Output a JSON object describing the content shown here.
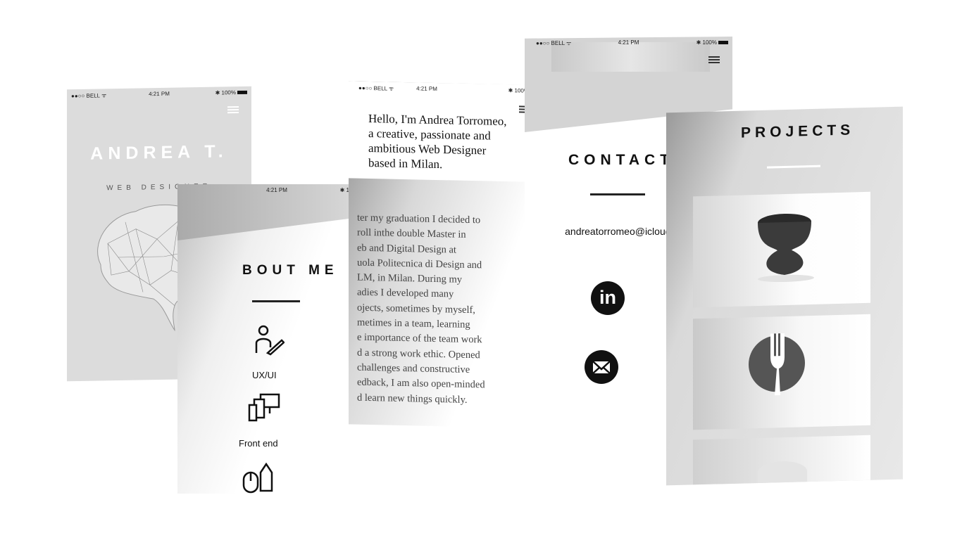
{
  "status": {
    "carrier": "●●○○ BELL ᯤ",
    "time": "4:21 PM",
    "battery": "✱ 100%"
  },
  "screen1": {
    "name": "ANDREA T.",
    "role": "WEB DESIGNER"
  },
  "screen2": {
    "title": "BOUT ME",
    "skills": [
      {
        "label": "UX/UI",
        "icon": "person-pen-icon"
      },
      {
        "label": "Front end",
        "icon": "devices-icon"
      },
      {
        "label": "",
        "icon": "mouse-pen-icon"
      }
    ]
  },
  "screen3": {
    "intro": "Hello, I'm Andrea Torromeo, a creative, passionate and ambitious Web Designer based in Milan.",
    "body_lines": [
      "ter my graduation I decided to",
      "roll inthe double Master in",
      "eb and Digital Design at",
      "uola Politecnica di Design and",
      "LM, in Milan. During my",
      "adies I developed many",
      "ojects, sometimes by myself,",
      "metimes in a team, learning",
      "e importance of the team work",
      "d a strong work ethic. Opened",
      "challenges and constructive",
      "edback, I am also open-minded",
      "d learn new things quickly."
    ]
  },
  "screen4": {
    "title": "CONTACTS",
    "email": "andreatorromeo@icloud.com",
    "icons": [
      "linkedin-icon",
      "mail-icon"
    ]
  },
  "screen5": {
    "title": "PROJECTS"
  }
}
